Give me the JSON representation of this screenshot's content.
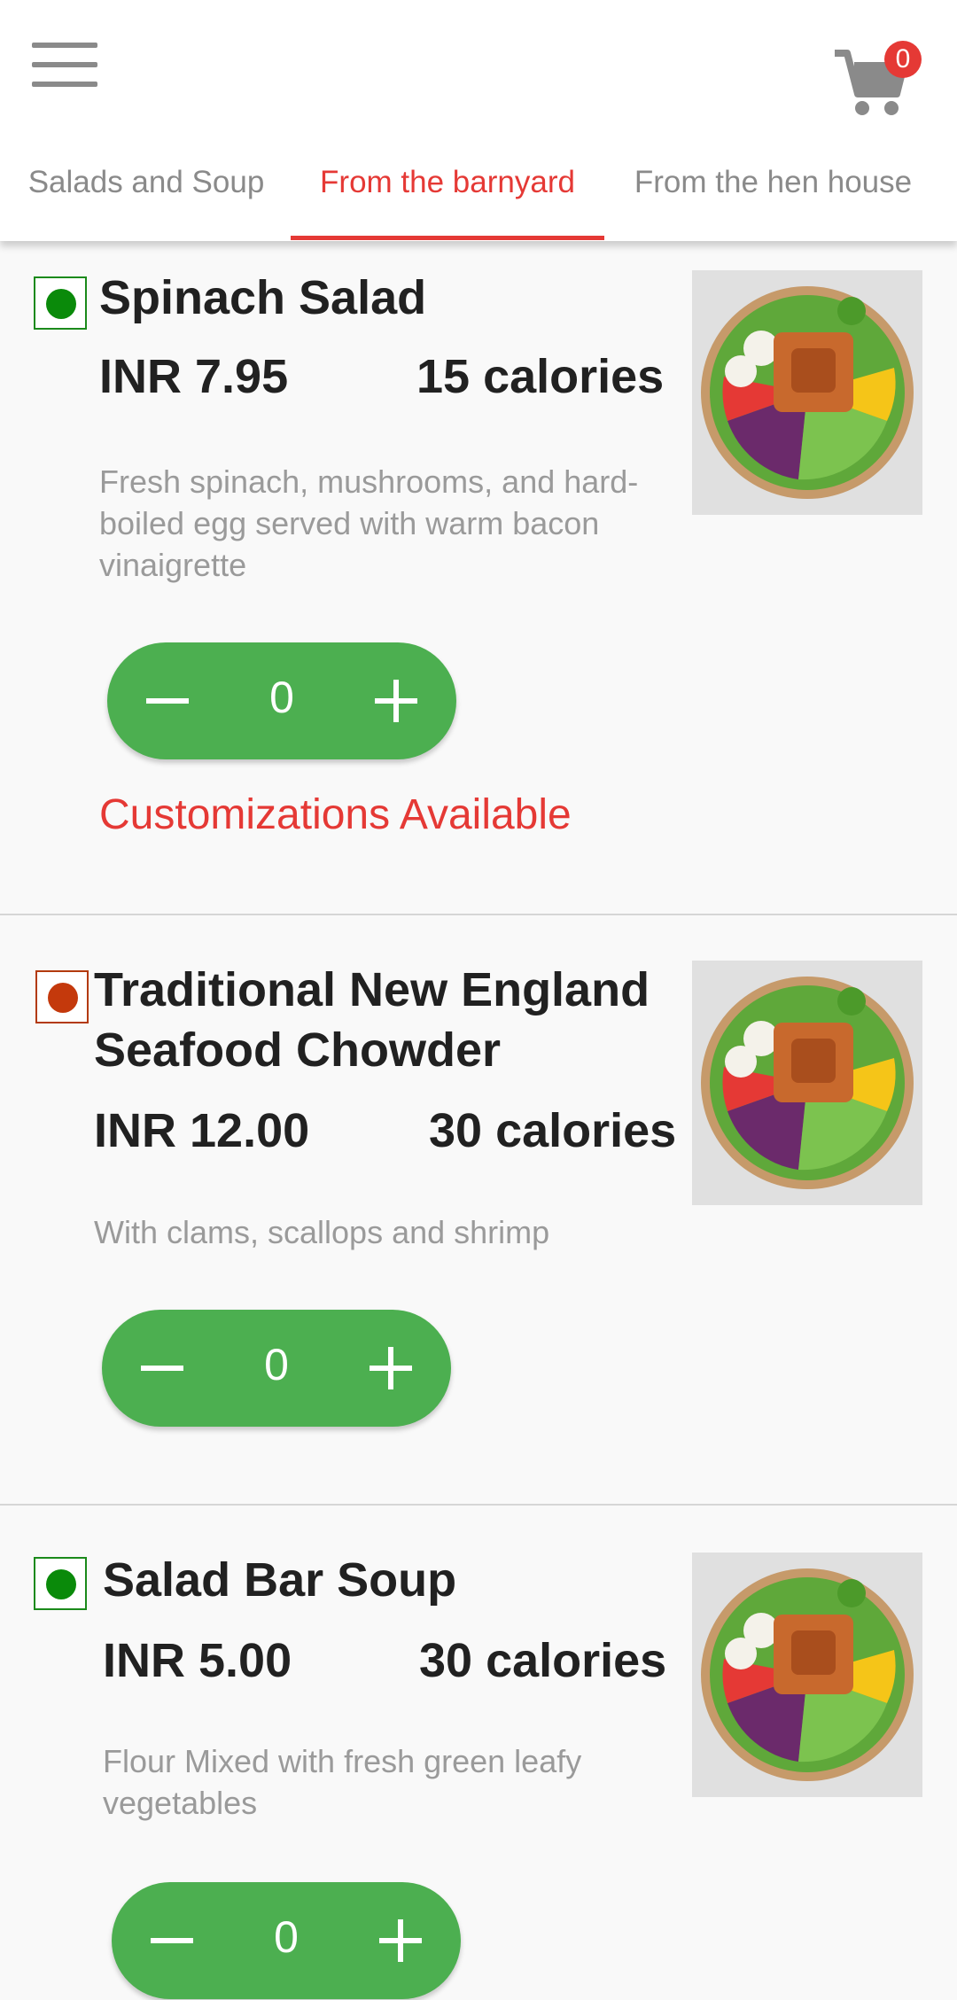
{
  "header": {
    "cart_count": "0",
    "tabs": [
      {
        "label": "Salads and Soup"
      },
      {
        "label": "From the barnyard"
      },
      {
        "label": "From the hen house"
      }
    ]
  },
  "items": [
    {
      "name": "Spinach Salad",
      "price": "INR 7.95",
      "calories": "15 calories",
      "description": "Fresh spinach, mushrooms, and hard-boiled egg served with warm bacon vinaigrette",
      "quantity": "0",
      "customization": "Customizations Available",
      "type": "veg"
    },
    {
      "name": "Traditional New England Seafood Chowder",
      "price": "INR 12.00",
      "calories": "30 calories",
      "description": "With clams, scallops and shrimp",
      "quantity": "0",
      "type": "non-veg"
    },
    {
      "name": "Salad Bar Soup",
      "price": "INR 5.00",
      "calories": "30 calories",
      "description": "Flour Mixed with fresh green leafy vegetables",
      "quantity": "0",
      "type": "veg"
    }
  ],
  "colors": {
    "accent": "#e53935",
    "stepper": "#4caf50",
    "veg": "#0a8a0a",
    "non_veg": "#c4390c"
  },
  "icons": {
    "menu": "hamburger-menu-icon",
    "cart": "shopping-cart-icon"
  }
}
